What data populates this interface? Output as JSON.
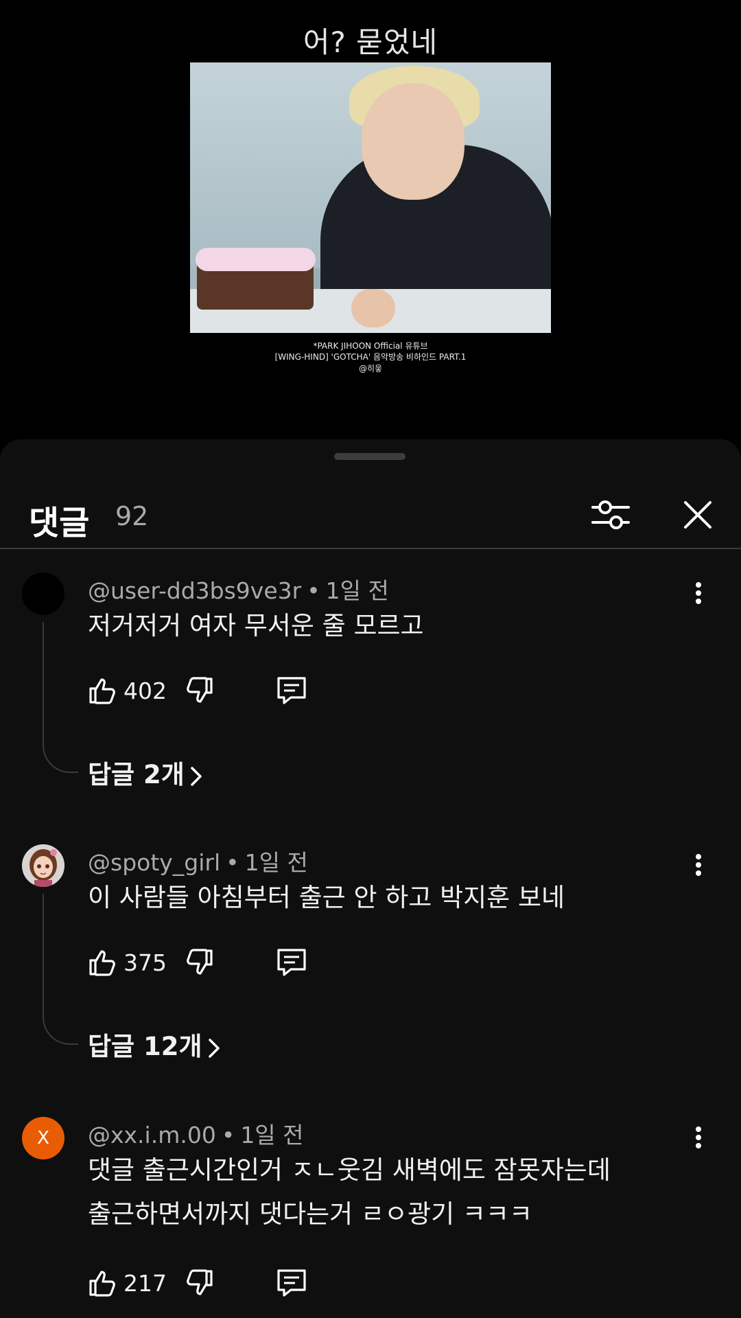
{
  "video": {
    "caption": "어? 묻었네",
    "credit_line1": "*PARK JIHOON Official 유튜브",
    "credit_line2": "[WING-HIND] 'GOTCHA' 음악방송 비하인드 PART.1",
    "credit_line3": "@히읗"
  },
  "comments_sheet": {
    "title": "댓글",
    "count": "92",
    "filter_icon": "sliders-icon",
    "close_icon": "close-icon"
  },
  "comments": [
    {
      "author": "@user-dd3bs9ve3r",
      "time": "1일 전",
      "text": [
        "저거저거 여자 무서운 줄 모르고"
      ],
      "likes": "402",
      "replies": "답글 2개",
      "avatar": "black-circle"
    },
    {
      "author": "@spoty_girl",
      "time": "1일 전",
      "text": [
        "이 사람들 아침부터 출근 안 하고 박지훈 보네"
      ],
      "likes": "375",
      "replies": "답글 12개",
      "avatar": "cartoon-girl"
    },
    {
      "author": "@xx.i.m.00",
      "time": "1일 전",
      "text": [
        "댓글 출근시간인거 ㅈㄴ웃김 새벽에도 잠못자는데",
        "출근하면서까지 댓다는거 ㄹㅇ광기 ㅋㅋㅋ"
      ],
      "likes": "217",
      "avatar_letter": "X"
    }
  ],
  "colors": {
    "sheet_bg": "#0f0f0f",
    "avatar_orange": "#e85d04",
    "secondary_text": "#aaaaaa"
  }
}
